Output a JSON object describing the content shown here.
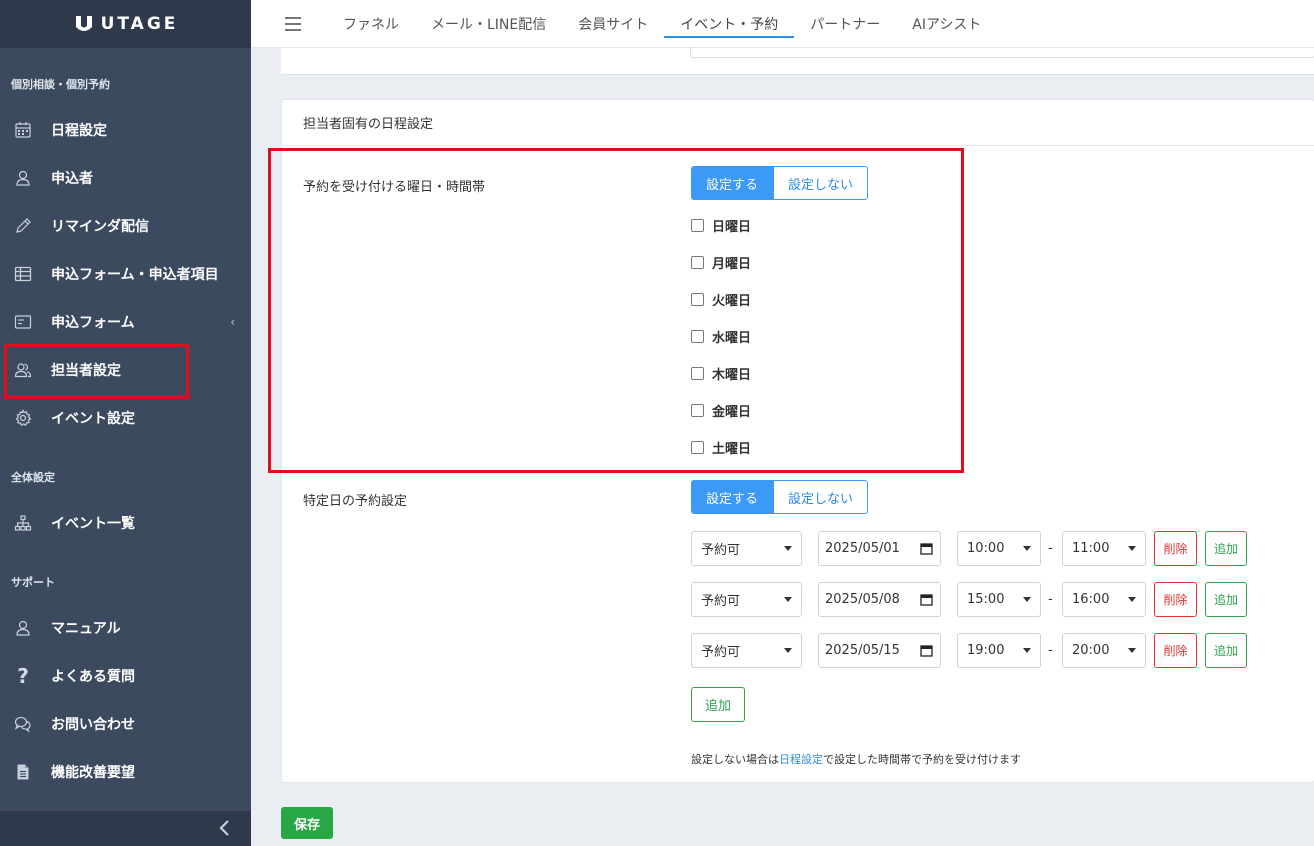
{
  "logo": {
    "text": "UTAGE"
  },
  "sidebar": {
    "section1": "個別相談・個別予約",
    "items1": [
      {
        "label": "日程設定",
        "icon": "calendar-icon"
      },
      {
        "label": "申込者",
        "icon": "user-icon"
      },
      {
        "label": "リマインダ配信",
        "icon": "pencil-icon"
      },
      {
        "label": "申込フォーム・申込者項目",
        "icon": "table-icon"
      },
      {
        "label": "申込フォーム",
        "icon": "form-icon",
        "chevron": "‹"
      },
      {
        "label": "担当者設定",
        "icon": "users-icon"
      },
      {
        "label": "イベント設定",
        "icon": "gear-icon"
      }
    ],
    "section2": "全体設定",
    "items2": [
      {
        "label": "イベント一覧",
        "icon": "sitemap-icon"
      }
    ],
    "section3": "サポート",
    "items3": [
      {
        "label": "マニュアル",
        "icon": "user-icon"
      },
      {
        "label": "よくある質問",
        "icon": "question-icon"
      },
      {
        "label": "お問い合わせ",
        "icon": "chat-icon"
      },
      {
        "label": "機能改善要望",
        "icon": "document-icon"
      }
    ]
  },
  "topnav": {
    "tabs": [
      "ファネル",
      "メール・LINE配信",
      "会員サイト",
      "イベント・予約",
      "パートナー",
      "AIアシスト"
    ],
    "active": "イベント・予約"
  },
  "card": {
    "title": "担当者固有の日程設定",
    "weekday_label": "予約を受け付ける曜日・時間帯",
    "toggle_on": "設定する",
    "toggle_off": "設定しない",
    "days": [
      "日曜日",
      "月曜日",
      "火曜日",
      "水曜日",
      "木曜日",
      "金曜日",
      "土曜日"
    ],
    "specific_label": "特定日の予約設定",
    "rows": [
      {
        "status": "予約可",
        "date": "2025/05/01",
        "start": "10:00",
        "end": "11:00"
      },
      {
        "status": "予約可",
        "date": "2025/05/08",
        "start": "15:00",
        "end": "16:00"
      },
      {
        "status": "予約可",
        "date": "2025/05/15",
        "start": "19:00",
        "end": "20:00"
      }
    ],
    "delete_label": "削除",
    "add_label": "追加",
    "dash": "-",
    "note_pre": "設定しない場合は",
    "note_link": "日程設定",
    "note_post": "で設定した時間帯で予約を受け付けます"
  },
  "save_label": "保存",
  "colors": {
    "sidebar": "#3b4a5e",
    "accent": "#3c99f5",
    "success": "#28a745",
    "danger": "#e3342f",
    "highlight": "#e0101a"
  }
}
